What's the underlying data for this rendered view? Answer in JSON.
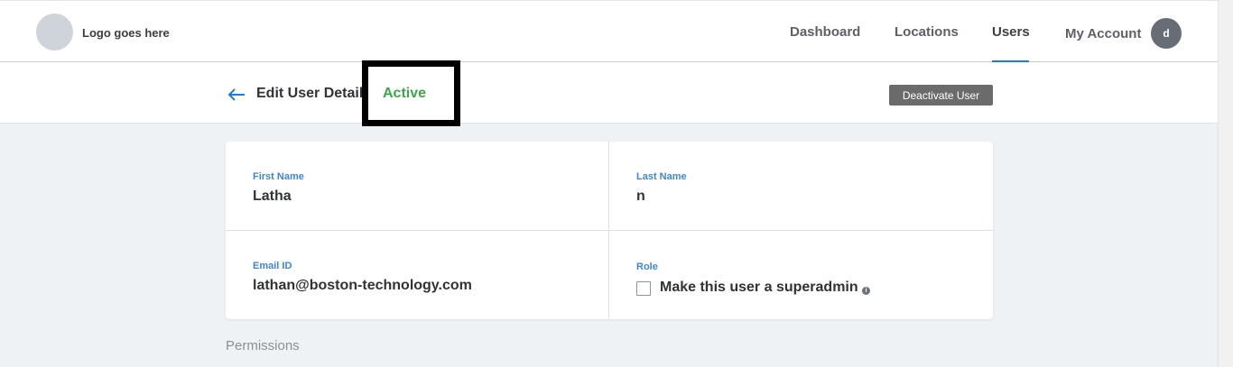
{
  "header": {
    "logo_text": "Logo goes here",
    "nav": {
      "dashboard": "Dashboard",
      "locations": "Locations",
      "users": "Users",
      "my_account": "My Account"
    },
    "active_nav": "Users",
    "avatar_initial": "d"
  },
  "subheader": {
    "title": "Edit User Detail",
    "status": "Active",
    "deactivate_label": "Deactivate User"
  },
  "form": {
    "first_name_label": "First Name",
    "first_name_value": "Latha",
    "last_name_label": "Last Name",
    "last_name_value": "n",
    "email_label": "Email ID",
    "email_value": "lathan@boston-technology.com",
    "role_label": "Role",
    "superadmin_label": "Make this user a superadmin",
    "superadmin_checked": false
  },
  "permissions_title": "Permissions",
  "colors": {
    "accent": "#1e7bd6",
    "status_active": "#3ea548",
    "label_blue": "#3c86d6"
  }
}
